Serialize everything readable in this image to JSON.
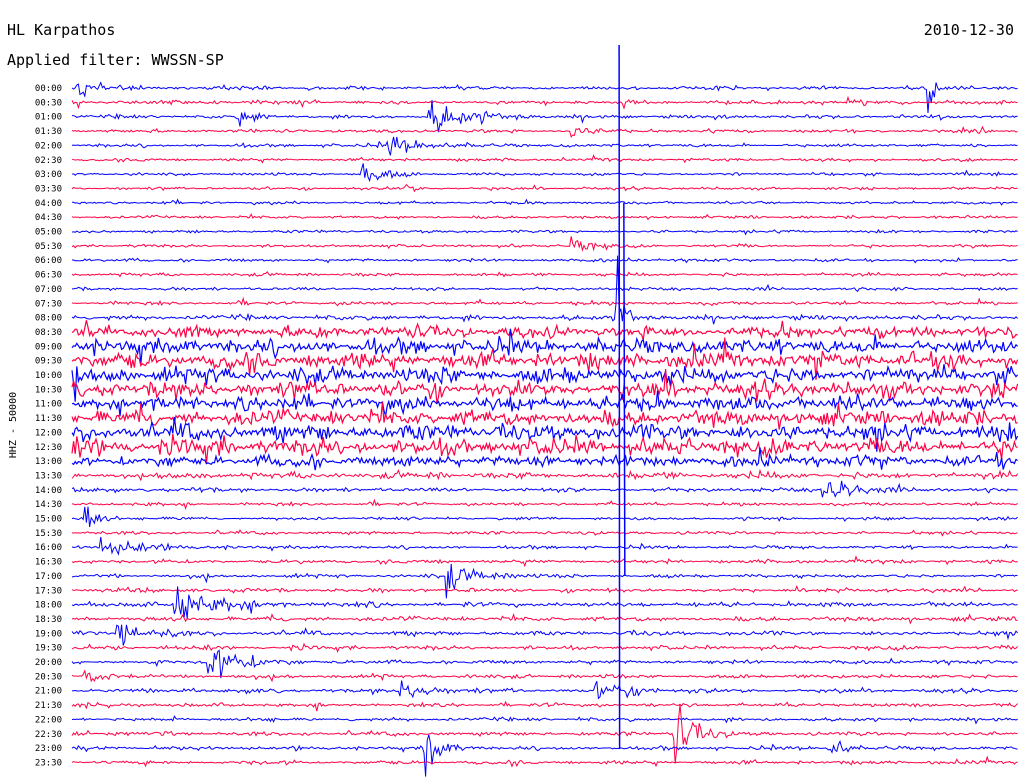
{
  "header": {
    "station": "HL Karpathos",
    "date": "2010-12-30",
    "filter": "Applied filter: WWSSN-SP"
  },
  "colors": {
    "trace_a": "#0000ff",
    "trace_b": "#ff0044",
    "background": "#ffffff",
    "text": "#000000"
  },
  "chart_data": {
    "type": "line",
    "subtype": "helicorder",
    "ylabel": "HHZ - 50000",
    "line_minutes": 30,
    "colors": [
      "#0000ff",
      "#ff0044"
    ],
    "time_labels": [
      "00:00",
      "00:30",
      "01:00",
      "01:30",
      "02:00",
      "02:30",
      "03:00",
      "03:30",
      "04:00",
      "04:30",
      "05:00",
      "05:30",
      "06:00",
      "06:30",
      "07:00",
      "07:30",
      "08:00",
      "08:30",
      "09:00",
      "09:30",
      "10:00",
      "10:30",
      "11:00",
      "11:30",
      "12:00",
      "12:30",
      "13:00",
      "13:30",
      "14:00",
      "14:30",
      "15:00",
      "15:30",
      "16:00",
      "16:30",
      "17:00",
      "17:30",
      "18:00",
      "18:30",
      "19:00",
      "19:30",
      "20:00",
      "20:30",
      "21:00",
      "21:30",
      "22:00",
      "22:30",
      "23:00",
      "23:30"
    ],
    "noise_level": [
      1.0,
      1.1,
      1.0,
      0.9,
      0.9,
      0.8,
      0.8,
      0.8,
      0.8,
      0.8,
      0.8,
      0.8,
      0.8,
      0.9,
      0.9,
      1.0,
      1.4,
      3.2,
      4.2,
      4.4,
      4.6,
      4.5,
      4.3,
      4.4,
      4.5,
      4.6,
      3.0,
      1.8,
      1.2,
      0.9,
      0.8,
      0.9,
      0.9,
      1.0,
      1.0,
      1.1,
      1.3,
      1.3,
      1.2,
      1.1,
      1.0,
      1.1,
      1.1,
      1.0,
      1.0,
      1.1,
      1.0,
      1.0
    ],
    "events": [
      {
        "line": 0,
        "minute": 0.2,
        "amplitude": 10,
        "duration_min": 0.6
      },
      {
        "line": 0,
        "minute": 27.1,
        "amplitude": 28,
        "duration_min": 0.3
      },
      {
        "line": 2,
        "minute": 11.3,
        "amplitude": 14,
        "duration_min": 1.6
      },
      {
        "line": 2,
        "minute": 5.3,
        "amplitude": 10,
        "duration_min": 0.5
      },
      {
        "line": 4,
        "minute": 10.0,
        "amplitude": 8,
        "duration_min": 1.5
      },
      {
        "line": 3,
        "minute": 15.8,
        "amplitude": 9,
        "duration_min": 0.7
      },
      {
        "line": 6,
        "minute": 9.2,
        "amplitude": 18,
        "duration_min": 0.8
      },
      {
        "line": 7,
        "minute": 10.6,
        "amplitude": 6,
        "duration_min": 0.4
      },
      {
        "line": 11,
        "minute": 15.8,
        "amplitude": 8,
        "duration_min": 0.7
      },
      {
        "line": 16,
        "minute": 17.3,
        "amplitude": 40,
        "duration_min": 0.3
      },
      {
        "line": 28,
        "minute": 23.8,
        "amplitude": 12,
        "duration_min": 1.2
      },
      {
        "line": 30,
        "minute": 0.4,
        "amplitude": 14,
        "duration_min": 0.6
      },
      {
        "line": 32,
        "minute": 0.9,
        "amplitude": 6,
        "duration_min": 2.0
      },
      {
        "line": 34,
        "minute": 11.8,
        "amplitude": 14,
        "duration_min": 1.3
      },
      {
        "line": 36,
        "minute": 3.2,
        "amplitude": 11,
        "duration_min": 2.2
      },
      {
        "line": 38,
        "minute": 1.4,
        "amplitude": 9,
        "duration_min": 1.2
      },
      {
        "line": 40,
        "minute": 4.3,
        "amplitude": 16,
        "duration_min": 1.4
      },
      {
        "line": 41,
        "minute": 0.4,
        "amplitude": 6,
        "duration_min": 0.8
      },
      {
        "line": 42,
        "minute": 10.4,
        "amplitude": 9,
        "duration_min": 1.2
      },
      {
        "line": 42,
        "minute": 16.6,
        "amplitude": 9,
        "duration_min": 1.6
      },
      {
        "line": 45,
        "minute": 19.1,
        "amplitude": 26,
        "duration_min": 0.8
      },
      {
        "line": 46,
        "minute": 11.2,
        "amplitude": 26,
        "duration_min": 0.6
      },
      {
        "line": 46,
        "minute": 24.0,
        "amplitude": 10,
        "duration_min": 0.6
      }
    ],
    "spikes": [
      {
        "minute": 17.35,
        "from_line": -3,
        "to_line": 46
      },
      {
        "minute": 17.5,
        "from_line": 8,
        "to_line": 34
      }
    ]
  }
}
